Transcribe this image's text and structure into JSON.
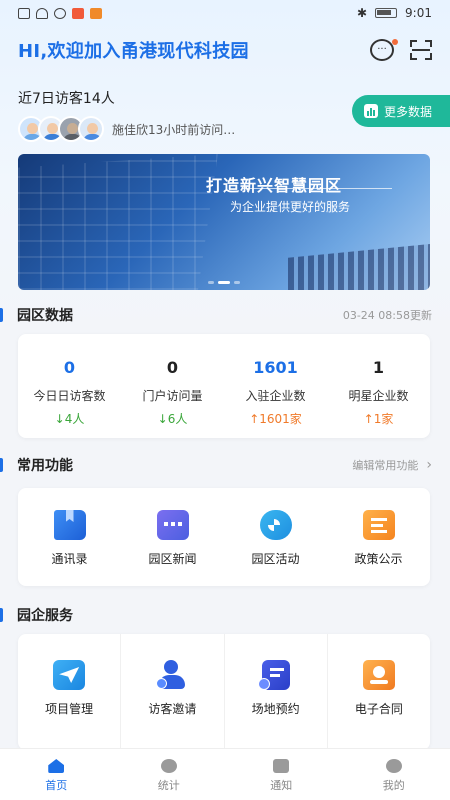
{
  "status_bar": {
    "time": "9:01"
  },
  "header": {
    "title": "HI,欢迎加入甬港现代科技园"
  },
  "visitors": {
    "title": "近7日访客14人",
    "recent": "施佳欣13小时前访问…",
    "more_button": "更多数据"
  },
  "banner": {
    "title": "打造新兴智慧园区",
    "subtitle": "为企业提供更好的服务",
    "slide_count": 3,
    "active_index": 1
  },
  "park_data": {
    "title": "园区数据",
    "updated": "03-24 08:58更新",
    "stats": [
      {
        "value": "0",
        "label": "今日日访客数",
        "delta": "↓4人",
        "value_color": "#1c6fe6",
        "delta_color": "#3aa63a"
      },
      {
        "value": "0",
        "label": "门户访问量",
        "delta": "↓6人",
        "value_color": "#222222",
        "delta_color": "#3aa63a"
      },
      {
        "value": "1601",
        "label": "入驻企业数",
        "delta": "↑1601家",
        "value_color": "#1c6fe6",
        "delta_color": "#f07a2a"
      },
      {
        "value": "1",
        "label": "明星企业数",
        "delta": "↑1家",
        "value_color": "#222222",
        "delta_color": "#f07a2a"
      }
    ]
  },
  "common_functions": {
    "title": "常用功能",
    "edit_label": "编辑常用功能",
    "items": [
      {
        "label": "通讯录",
        "icon": "contacts-book-icon"
      },
      {
        "label": "园区新闻",
        "icon": "news-chat-icon"
      },
      {
        "label": "园区活动",
        "icon": "activity-gamepad-icon"
      },
      {
        "label": "政策公示",
        "icon": "policy-document-icon"
      }
    ]
  },
  "enterprise_services": {
    "title": "园企服务",
    "items": [
      {
        "label": "项目管理",
        "icon": "paper-plane-icon"
      },
      {
        "label": "访客邀请",
        "icon": "add-visitor-icon"
      },
      {
        "label": "场地预约",
        "icon": "venue-booking-icon"
      },
      {
        "label": "电子合同",
        "icon": "e-contract-icon"
      }
    ]
  },
  "tabbar": {
    "items": [
      {
        "label": "首页",
        "icon": "home-icon",
        "active": true
      },
      {
        "label": "统计",
        "icon": "statistics-icon",
        "active": false
      },
      {
        "label": "通知",
        "icon": "notification-icon",
        "active": false
      },
      {
        "label": "我的",
        "icon": "profile-icon",
        "active": false
      }
    ]
  },
  "colors": {
    "primary": "#1c6fe6",
    "accent_green": "#1fb89a",
    "up": "#f07a2a",
    "down": "#3aa63a"
  }
}
